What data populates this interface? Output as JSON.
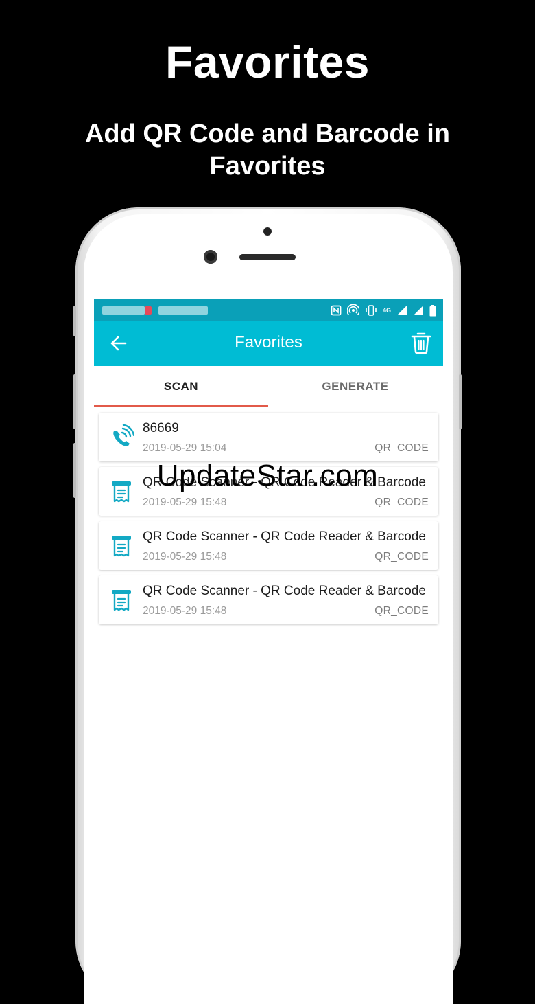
{
  "promo": {
    "title": "Favorites",
    "subtitle": "Add QR Code and Barcode in Favorites"
  },
  "status_bar": {
    "icons": [
      "nfc-icon",
      "hotspot-icon",
      "vibrate-icon",
      "4g-icon",
      "signal-icon",
      "battery-icon"
    ],
    "network_label": "4G"
  },
  "app_bar": {
    "title": "Favorites",
    "color": "#00bcd4"
  },
  "tabs": [
    {
      "label": "SCAN",
      "active": true
    },
    {
      "label": "GENERATE",
      "active": false
    }
  ],
  "items": [
    {
      "icon": "phone-call-icon",
      "title": "86669",
      "date": "2019-05-29 15:04",
      "type": "QR_CODE"
    },
    {
      "icon": "receipt-icon",
      "title": "QR Code Scanner - QR Code Reader & Barcode",
      "date": "2019-05-29 15:48",
      "type": "QR_CODE"
    },
    {
      "icon": "receipt-icon",
      "title": "QR Code Scanner - QR Code Reader & Barcode",
      "date": "2019-05-29 15:48",
      "type": "QR_CODE"
    },
    {
      "icon": "receipt-icon",
      "title": "QR Code Scanner - QR Code Reader & Barcode",
      "date": "2019-05-29 15:48",
      "type": "QR_CODE"
    }
  ],
  "watermark": "UpdateStar.com",
  "colors": {
    "accent": "#00bcd4",
    "status_bar": "#0aa0b8",
    "tab_indicator": "#e25a4a"
  }
}
